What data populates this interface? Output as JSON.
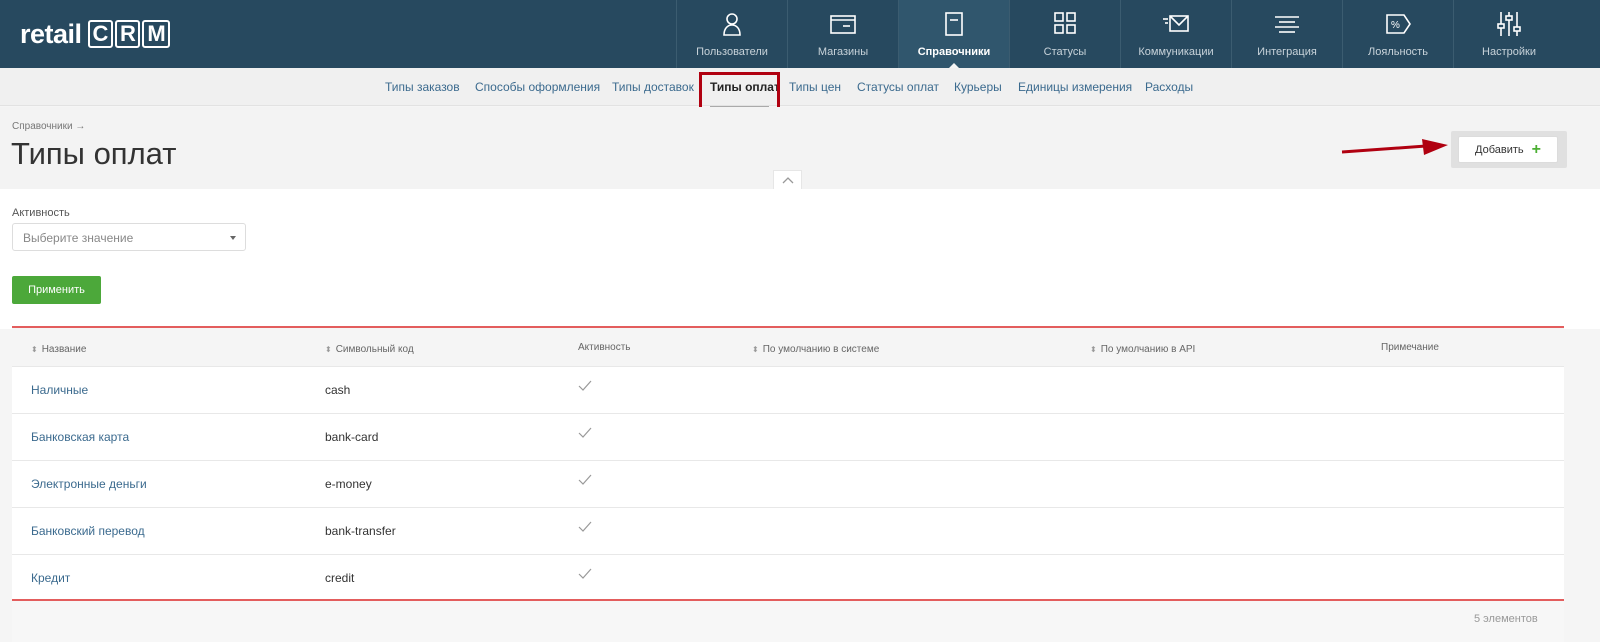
{
  "app": {
    "logo_text": "retail",
    "logo_crm": [
      "C",
      "R",
      "M"
    ]
  },
  "nav": [
    {
      "label": "Пользователи",
      "icon": "user-icon"
    },
    {
      "label": "Магазины",
      "icon": "store-icon"
    },
    {
      "label": "Справочники",
      "icon": "book-icon",
      "active": true
    },
    {
      "label": "Статусы",
      "icon": "status-grid-icon"
    },
    {
      "label": "Коммуникации",
      "icon": "envelope-icon"
    },
    {
      "label": "Интеграция",
      "icon": "integration-icon"
    },
    {
      "label": "Лояльность",
      "icon": "percent-tag-icon"
    },
    {
      "label": "Настройки",
      "icon": "sliders-icon"
    }
  ],
  "subnav": [
    {
      "label": "Типы заказов"
    },
    {
      "label": "Способы оформления"
    },
    {
      "label": "Типы доставок"
    },
    {
      "label": "Типы оплат",
      "active": true
    },
    {
      "label": "Типы цен"
    },
    {
      "label": "Статусы оплат"
    },
    {
      "label": "Курьеры"
    },
    {
      "label": "Единицы измерения"
    },
    {
      "label": "Расходы"
    }
  ],
  "breadcrumb": "Справочники →",
  "page_title": "Типы оплат",
  "add_button": {
    "label": "Добавить",
    "icon": "plus-icon"
  },
  "filter": {
    "label": "Активность",
    "placeholder": "Выберите значение",
    "apply_label": "Применить"
  },
  "table": {
    "headers": [
      {
        "label": "Название",
        "sortable": true
      },
      {
        "label": "Символьный код",
        "sortable": true
      },
      {
        "label": "Активность",
        "sortable": false
      },
      {
        "label": "По умолчанию в системе",
        "sortable": true
      },
      {
        "label": "По умолчанию в API",
        "sortable": true
      },
      {
        "label": "Примечание",
        "sortable": false
      }
    ],
    "rows": [
      {
        "name": "Наличные",
        "code": "cash",
        "active": true
      },
      {
        "name": "Банковская карта",
        "code": "bank-card",
        "active": true
      },
      {
        "name": "Электронные деньги",
        "code": "e-money",
        "active": true
      },
      {
        "name": "Банковский перевод",
        "code": "bank-transfer",
        "active": true
      },
      {
        "name": "Кредит",
        "code": "credit",
        "active": true
      }
    ],
    "footer_count": "5 элементов"
  },
  "colors": {
    "topbar": "#27495f",
    "accent_green": "#4ca83a",
    "highlight_red": "#b00010",
    "table_border": "#e35d5d",
    "link": "#3b6a8e"
  }
}
